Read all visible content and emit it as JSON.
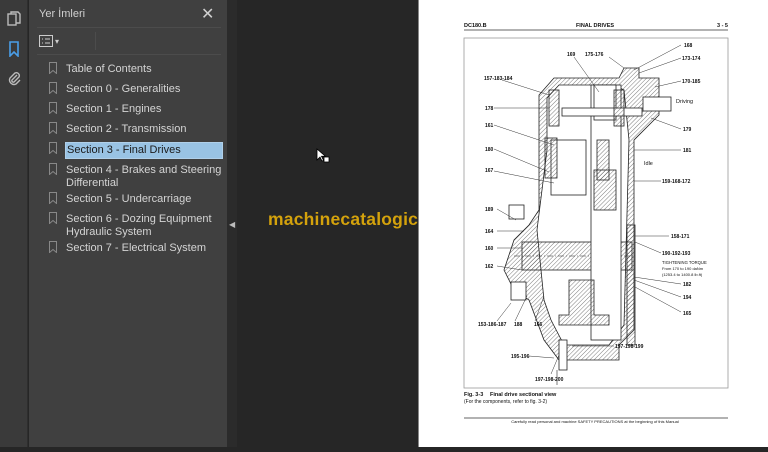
{
  "sidebar": {
    "title": "Yer İmleri",
    "icons": [
      "pages-icon",
      "bookmark-icon",
      "attachment-icon"
    ],
    "items": [
      {
        "label": "Table of Contents"
      },
      {
        "label": "Section 0 - Generalities"
      },
      {
        "label": "Section 1 - Engines"
      },
      {
        "label": "Section 2 - Transmission"
      },
      {
        "label": "Section 3 - Final Drives",
        "selected": true
      },
      {
        "label": "Section 4 - Brakes and Steering Differential"
      },
      {
        "label": "Section 5 - Undercarriage"
      },
      {
        "label": "Section 6 - Dozing Equipment Hydraulic System"
      },
      {
        "label": "Section 7 - Electrical System"
      }
    ]
  },
  "accent": "#4a9ee8",
  "selection_color": "#99c3e4",
  "watermark": "machinecatalogic.com",
  "document": {
    "header_left": "DC180.B",
    "header_center": "FINAL DRIVES",
    "header_right": "3 - 5",
    "labels": {
      "l168": "168",
      "l173": "173-174",
      "l169": "169",
      "l175": "175-176",
      "l157": "157-183-184",
      "l170": "170-185",
      "driving": "Driving",
      "l178": "178",
      "l179": "179",
      "l161": "161",
      "l181": "181",
      "l180": "180",
      "idle": "Idle",
      "l167": "167",
      "l159": "159-168-172",
      "l189": "189",
      "l164": "164",
      "l158": "158-171",
      "l160": "160",
      "l190": "190-192-193",
      "torque1": "TIGHTENING TORQUE",
      "torque2": "From 170 to 190 daNm",
      "torque3": "(1253.4 to 1400.8 lb.ft)",
      "l162": "162",
      "l182": "182",
      "l194": "194",
      "l165": "165",
      "l153": "153-186-187",
      "l188": "188",
      "l166": "166",
      "l197a": "197-198-199",
      "l195": "195-196",
      "l197b": "197-198-200"
    },
    "caption_fig": "Fig. 3-3",
    "caption_title": "Final drive sectional view",
    "caption_note": "(For the components, refer to fig. 3-2)",
    "footer": "Carefully read personal and machine SAFETY PRECAUTIONS at the beginning of this Manual"
  }
}
